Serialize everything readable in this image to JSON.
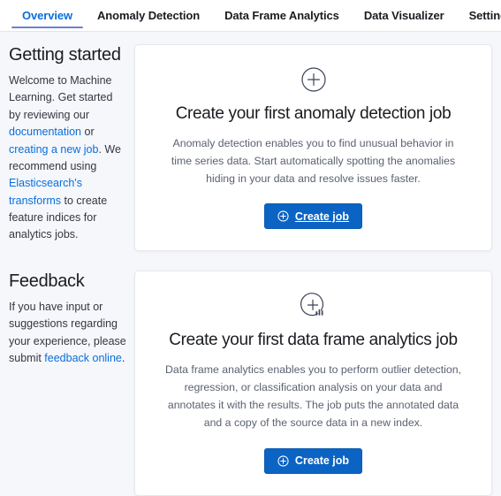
{
  "tabs": [
    {
      "label": "Overview",
      "selected": true
    },
    {
      "label": "Anomaly Detection",
      "selected": false
    },
    {
      "label": "Data Frame Analytics",
      "selected": false
    },
    {
      "label": "Data Visualizer",
      "selected": false
    },
    {
      "label": "Settings",
      "selected": false
    }
  ],
  "sidebar": {
    "getting_started": {
      "title": "Getting started",
      "text_1": "Welcome to Machine Learning. Get started by reviewing our ",
      "link_documentation": "documentation",
      "text_2": " or ",
      "link_creating_job": "creating a new job",
      "text_3": ". We recommend using ",
      "link_transforms": "Elasticsearch's transforms",
      "text_4": " to create feature indices for analytics jobs."
    },
    "feedback": {
      "title": "Feedback",
      "text_1": "If you have input or suggestions regarding your experience, please submit ",
      "link_feedback": "feedback online",
      "text_2": "."
    }
  },
  "cards": [
    {
      "icon": "plus-circle-icon",
      "title": "Create your first anomaly detection job",
      "description": "Anomaly detection enables you to find unusual behavior in time series data. Start automatically spotting the anomalies hiding in your data and resolve issues faster.",
      "button_label": "Create job",
      "button_icon": "plus-in-circle-icon",
      "button_hovered": true
    },
    {
      "icon": "plus-circle-bars-icon",
      "title": "Create your first data frame analytics job",
      "description": "Data frame analytics enables you to perform outlier detection, regression, or classification analysis on your data and annotates it with the results. The job puts the annotated data and a copy of the source data in a new index.",
      "button_label": "Create job",
      "button_icon": "plus-in-circle-icon",
      "button_hovered": false
    }
  ],
  "colors": {
    "accent": "#0a6edc",
    "button_bg": "#0b64c4",
    "page_bg": "#f5f7fa",
    "card_bg": "#ffffff",
    "text": "#343741",
    "muted_text": "#5b6171"
  }
}
